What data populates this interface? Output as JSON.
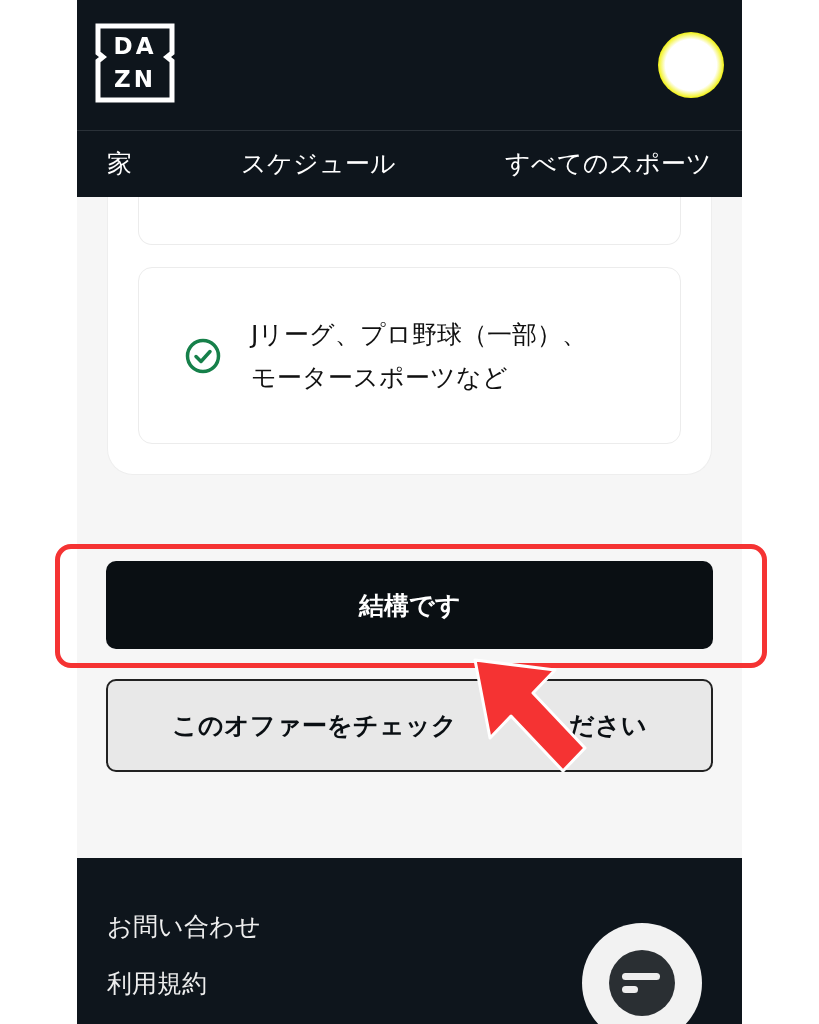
{
  "header": {
    "logo": {
      "top": "DA",
      "bottom": "ZN"
    }
  },
  "nav": [
    {
      "label": "家"
    },
    {
      "label": "スケジュール"
    },
    {
      "label": "すべてのスポーツ"
    }
  ],
  "plan_cards": [
    {
      "kind": "blank"
    },
    {
      "kind": "feature",
      "checked": true,
      "text": "Jリーグ、プロ野球（一部）、モータースポーツなど"
    }
  ],
  "buttons": [
    {
      "kind": "primary",
      "label": "結構です",
      "highlighted": true
    },
    {
      "kind": "secondary",
      "label_parts": [
        "このオファーをチェック",
        "ださい"
      ]
    }
  ],
  "footer": {
    "links": [
      "お問い合わせ",
      "利用規約"
    ]
  }
}
